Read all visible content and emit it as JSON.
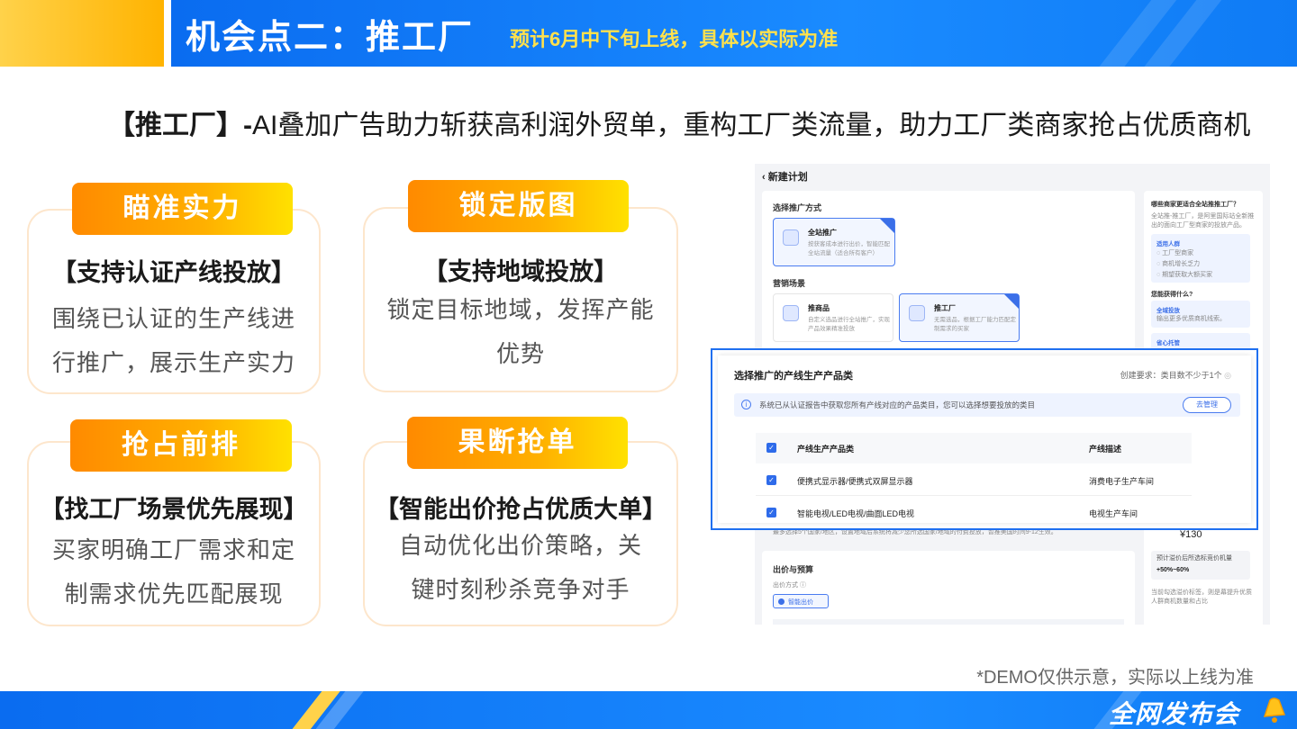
{
  "header": {
    "title": "机会点二：推工厂",
    "subtitle": "预计6月中下旬上线，具体以实际为准"
  },
  "headline": {
    "bold": "【推工厂】-",
    "rest": "AI叠加广告助力斩获高利润外贸单，重构工厂类流量，助力工厂类商家抢占优质商机"
  },
  "cards": [
    {
      "pill": "瞄准实力",
      "sub": "【支持认证产线投放】",
      "body": [
        "围绕已认证的生产线进",
        "行推广，展示生产实力"
      ]
    },
    {
      "pill": "锁定版图",
      "sub": "【支持地域投放】",
      "body": [
        "锁定目标地域，发挥产能",
        "优势"
      ]
    },
    {
      "pill": "抢占前排",
      "sub": "【找工厂场景优先展现】",
      "body": [
        "买家明确工厂需求和定",
        "制需求优先匹配展现"
      ]
    },
    {
      "pill": "果断抢单",
      "sub": "【智能出价抢占优质大单】",
      "body": [
        "自动优化出价策略，关",
        "键时刻秒杀竞争对手"
      ]
    }
  ],
  "screenshot": {
    "back_title": "‹ 新建计划",
    "section_method": "选择推广方式",
    "opt_all": {
      "name": "全站推广",
      "desc": "按获客成本进行出价，智能匹配全站流量（适合所有客户）"
    },
    "section_scene": "营销场景",
    "opt_product": {
      "name": "推商品",
      "desc": "自定义选品进行全站推广，实现产品效果精准投放"
    },
    "opt_factory": {
      "name": "推工厂",
      "desc": "无需选品，根据工厂能力匹配定制需求的买家"
    },
    "side_question": "哪些商家更适合全站推推工厂？",
    "side_desc": "全站推-推工厂，是阿里国际站全新推出的面向工厂型商家的投放产品。",
    "side_crowd_title": "适用人群",
    "side_crowd": [
      "工厂型商家",
      "商机增长乏力",
      "期望获取大额买家"
    ],
    "side_gain": "您能获得什么?",
    "side_gain_1": "全域投放",
    "side_gain_1_desc": "输出更多优质商机线索。",
    "side_gain_2": "省心托管",
    "price": "¥130",
    "side_rank_title": "预计溢价后所选标竞价机量",
    "side_rank_value": "+50%~60%",
    "side_rank_desc": "当前勾选溢价标签，则是幕提升优质人群商机数量和占比",
    "bid_section": "出价与预算",
    "bid_method": "出价方式 ⓘ",
    "bid_smart": "智能出价",
    "small_note": "最多选择5个国家/地区，设置地域后系统将减少您所选国家/地域的付费投放，暂推美国时间9-12生效。"
  },
  "dialog": {
    "title": "选择推广的产线生产产品类",
    "requirement": "创建要求：类目数不少于1个",
    "info": "系统已从认证报告中获取您所有产线对应的产品类目，您可以选择想要投放的类目",
    "manage_btn": "去管理",
    "col1": "产线生产产品类",
    "col2": "产线描述",
    "rows": [
      {
        "product": "便携式显示器/便携式双屏显示器",
        "desc": "消费电子生产车间"
      },
      {
        "product": "智能电视/LED电视/曲面LED电视",
        "desc": "电视生产车间"
      }
    ]
  },
  "disclaimer": "*DEMO仅供示意，实际以上线为准",
  "footer": {
    "brand": "全网发布会"
  },
  "colors": {
    "brand_blue": "#0a6cf0",
    "accent_orange": "#ff8a00",
    "accent_yellow": "#ffe14d"
  }
}
